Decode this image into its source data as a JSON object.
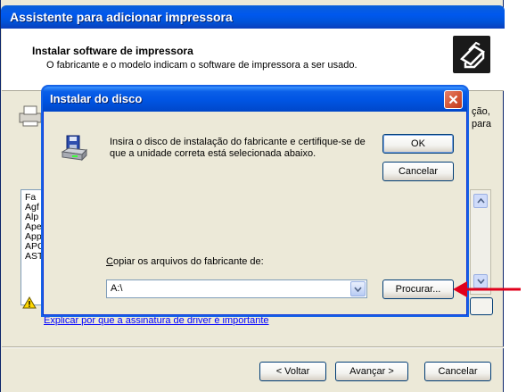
{
  "wizard": {
    "title": "Assistente para adicionar impressora",
    "header_title": "Instalar software de impressora",
    "header_subtitle": "O fabricante e o modelo indicam o software de impressora a ser usado.",
    "right_text_line1": "ção,",
    "right_text_line2": "para",
    "list_items": [
      "Fa",
      "Agf",
      "Alp",
      "Ape",
      "App",
      "APC",
      "AST"
    ],
    "driver_link": "Explicar por que a assinatura de driver é importante",
    "back_label": "< Voltar",
    "next_label": "Avançar >",
    "cancel_label": "Cancelar"
  },
  "dialog": {
    "title": "Instalar do disco",
    "message": "Insira o disco de instalação do fabricante e certifique-se de que a unidade correta está selecionada abaixo.",
    "ok_label": "OK",
    "cancel_label": "Cancelar",
    "copy_label_rest": "opiar os arquivos do fabricante de:",
    "copy_label_accel": "C",
    "path_value": "A:\\",
    "browse_label": "Procurar..."
  },
  "colors": {
    "titlebar_blue": "#0054e3",
    "dialog_face": "#ece9d8",
    "link_blue": "#0000ff",
    "arrow_red": "#e0001b"
  }
}
